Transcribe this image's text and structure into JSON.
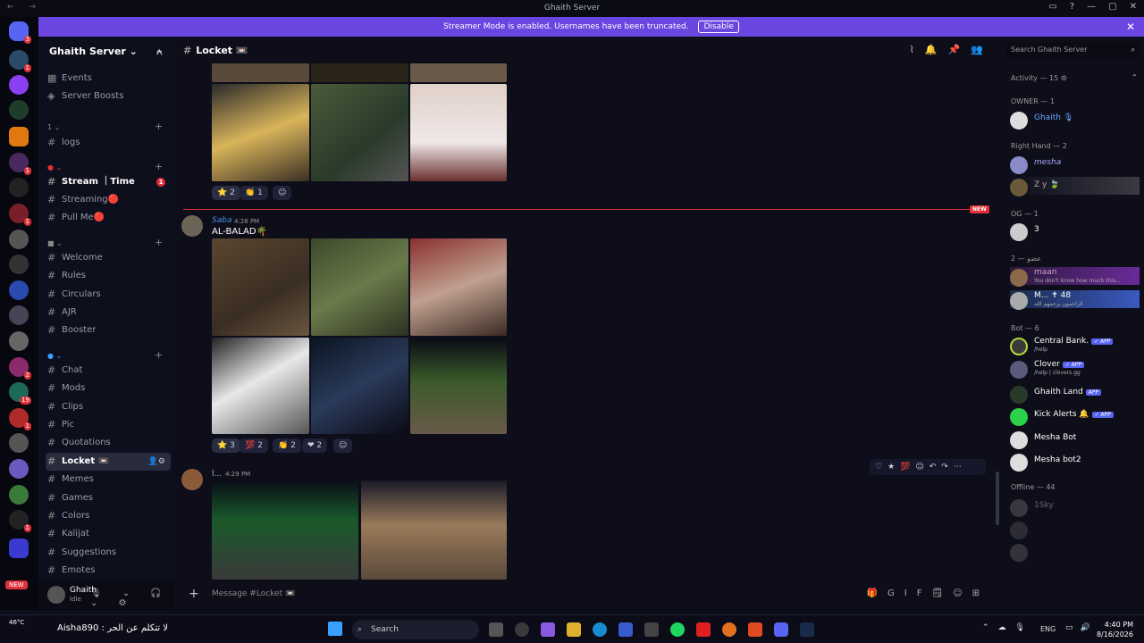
{
  "window": {
    "title": "Ghaith Server",
    "controls": [
      "▭",
      "?",
      "—",
      "▢",
      "✕"
    ]
  },
  "banner": {
    "text": "Streamer Mode is enabled. Usernames have been truncated.",
    "button": "Disable",
    "close": "✕"
  },
  "server": {
    "name": "Ghaith Server ⌄",
    "invite": "⍲"
  },
  "channels": {
    "events": "Events",
    "boosts": "Server Boosts",
    "cat1": "1 ⌄",
    "logs": "logs",
    "stream": "Stream ｜Time",
    "streaming": "Streaming🔴",
    "pullme": "Pull Me🔴",
    "welcome": "Welcome",
    "rules": "Rules",
    "circulars": "Circulars",
    "ajr": "AJR",
    "booster": "Booster",
    "chat": "Chat",
    "mods": "Mods",
    "clips": "Clips",
    "pic": "Pic",
    "quotations": "Quotations",
    "locket": "Locket 📼",
    "memes": "Memes",
    "games": "Games",
    "colors": "Colors",
    "kalijat": "Kalijat",
    "suggestions": "Suggestions",
    "emotes": "Emotes",
    "badge": "1"
  },
  "user": {
    "name": "Ghaith",
    "status": "Idle",
    "icons": "🎙 ⌄ 🎧 ⌄ ⚙"
  },
  "header": {
    "channel": "Locket 📼",
    "icons": "⌇🔔📌👥"
  },
  "messages": [
    {
      "reactions": [
        "⭐ 2",
        "👏 1",
        "☺"
      ]
    },
    {
      "user": "Saba",
      "time": "4:26 PM",
      "text": "AL-BALAD🌴",
      "reactions": [
        "⭐ 3",
        "💯 2",
        "👏 2",
        "❤ 2",
        "☺"
      ]
    },
    {
      "user": "l...",
      "time": "4:29 PM"
    }
  ],
  "new_label": "NEW",
  "hover_toolbar": "♡★💯☺↶↷⋯",
  "composer": {
    "placeholder": "Message #Locket 📼",
    "icons": "🎁GIF🗒☺⊞"
  },
  "members_panel": {
    "search": "Search Ghaith Server",
    "activity": "Activity — 15 ⚙",
    "groups": [
      {
        "label": "OWNER — 1",
        "members": [
          {
            "name": "Ghaith 🎙"
          }
        ]
      },
      {
        "label": "Right Hand — 2",
        "members": [
          {
            "name": "mesha"
          },
          {
            "name": "Z y 🍃"
          }
        ]
      },
      {
        "label": "OG — 1",
        "members": [
          {
            "name": "3"
          }
        ]
      },
      {
        "label": "عضو — 2",
        "members": [
          {
            "name": "maan",
            "sub": "You don't know how much this..."
          },
          {
            "name": "M... ✝ 48",
            "sub": "الراحمون يرحمهم الله"
          }
        ]
      },
      {
        "label": "Bot — 6",
        "members": [
          {
            "name": "Central Bank.",
            "sub": "/help",
            "tag": "✓ APP"
          },
          {
            "name": "Clover",
            "sub": "/help | clovers.gg",
            "tag": "✓ APP"
          },
          {
            "name": "Ghaith Land",
            "tag": "APP"
          },
          {
            "name": "Kick Alerts 🔔",
            "tag": "✓ APP"
          },
          {
            "name": "Mesha Bot"
          },
          {
            "name": "Mesha bot2"
          }
        ]
      },
      {
        "label": "Offline — 44",
        "members": [
          {
            "name": "1Sky"
          }
        ]
      }
    ]
  },
  "taskbar": {
    "temp": "46°C",
    "news": "Aisha890 : لا تتكلم عن الحر",
    "search": "Search",
    "lang": "ENG",
    "time": "4:40 PM",
    "date": "8/16/2026"
  }
}
